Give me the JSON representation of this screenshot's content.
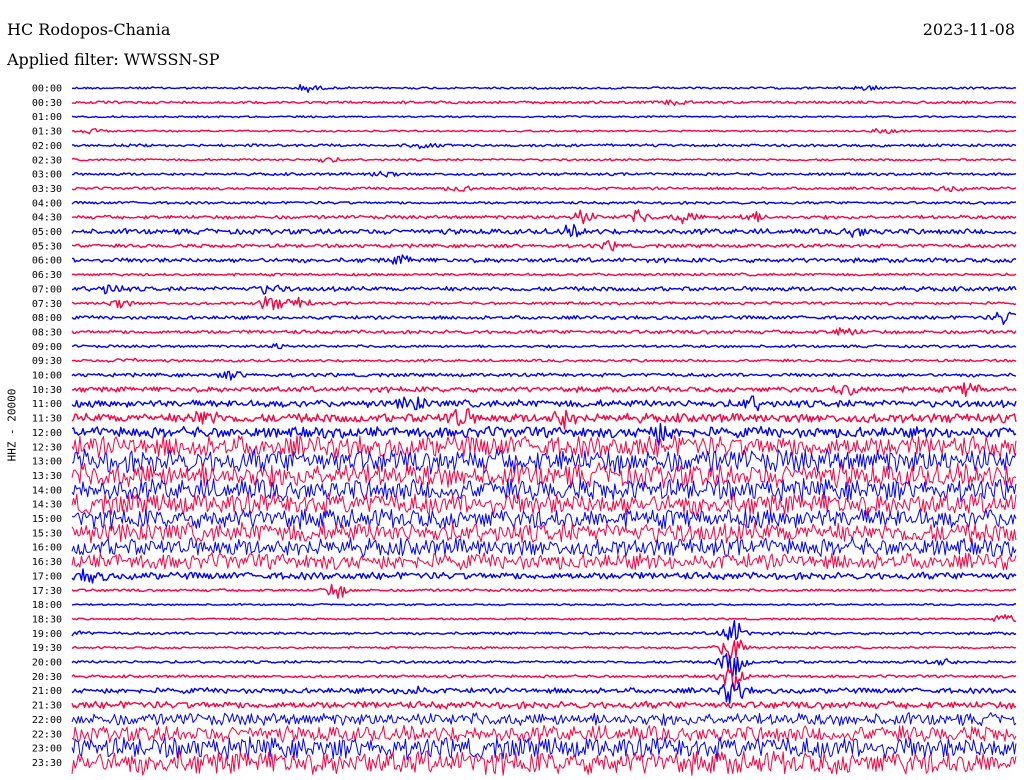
{
  "header": {
    "station": "HC Rodopos-Chania",
    "date": "2023-11-08",
    "filter": "Applied filter: WWSSN-SP"
  },
  "chart_data": {
    "type": "line",
    "ylabel": "HHZ - 20000",
    "colors": {
      "even": "#0000ff",
      "odd": "#ff0040"
    },
    "rows": [
      {
        "label": "00:00",
        "amp": 1.2,
        "events": [
          {
            "pos": 0.25,
            "amp": 4
          },
          {
            "pos": 0.84,
            "amp": 3
          }
        ]
      },
      {
        "label": "00:30",
        "amp": 1.5,
        "events": [
          {
            "pos": 0.64,
            "amp": 3
          }
        ]
      },
      {
        "label": "01:00",
        "amp": 1.0,
        "events": []
      },
      {
        "label": "01:30",
        "amp": 1.0,
        "events": [
          {
            "pos": 0.02,
            "amp": 3
          },
          {
            "pos": 0.86,
            "amp": 3
          }
        ]
      },
      {
        "label": "02:00",
        "amp": 1.5,
        "events": [
          {
            "pos": 0.37,
            "amp": 3
          }
        ]
      },
      {
        "label": "02:30",
        "amp": 1.2,
        "events": [
          {
            "pos": 0.27,
            "amp": 3
          }
        ]
      },
      {
        "label": "03:00",
        "amp": 1.5,
        "events": [
          {
            "pos": 0.33,
            "amp": 4
          }
        ]
      },
      {
        "label": "03:30",
        "amp": 1.5,
        "events": [
          {
            "pos": 0.41,
            "amp": 3
          },
          {
            "pos": 0.93,
            "amp": 3
          }
        ]
      },
      {
        "label": "04:00",
        "amp": 1.5,
        "events": []
      },
      {
        "label": "04:30",
        "amp": 2.0,
        "events": [
          {
            "pos": 0.54,
            "amp": 7
          },
          {
            "pos": 0.6,
            "amp": 6
          },
          {
            "pos": 0.65,
            "amp": 6
          },
          {
            "pos": 0.72,
            "amp": 5
          }
        ]
      },
      {
        "label": "05:00",
        "amp": 3.0,
        "events": [
          {
            "pos": 0.53,
            "amp": 5
          },
          {
            "pos": 0.83,
            "amp": 5
          }
        ]
      },
      {
        "label": "05:30",
        "amp": 2.0,
        "events": [
          {
            "pos": 0.57,
            "amp": 4
          }
        ]
      },
      {
        "label": "06:00",
        "amp": 2.5,
        "events": [
          {
            "pos": 0.35,
            "amp": 4
          }
        ]
      },
      {
        "label": "06:30",
        "amp": 1.5,
        "events": []
      },
      {
        "label": "07:00",
        "amp": 2.5,
        "events": [
          {
            "pos": 0.04,
            "amp": 5
          },
          {
            "pos": 0.21,
            "amp": 5
          }
        ]
      },
      {
        "label": "07:30",
        "amp": 1.5,
        "events": [
          {
            "pos": 0.05,
            "amp": 5
          },
          {
            "pos": 0.21,
            "amp": 8
          },
          {
            "pos": 0.24,
            "amp": 6
          }
        ]
      },
      {
        "label": "08:00",
        "amp": 2.0,
        "events": [
          {
            "pos": 0.99,
            "amp": 8
          }
        ]
      },
      {
        "label": "08:30",
        "amp": 2.0,
        "events": [
          {
            "pos": 0.82,
            "amp": 5
          }
        ]
      },
      {
        "label": "09:00",
        "amp": 1.5,
        "events": [
          {
            "pos": 0.22,
            "amp": 3
          }
        ]
      },
      {
        "label": "09:30",
        "amp": 1.5,
        "events": [
          {
            "pos": 0.06,
            "amp": 3
          }
        ]
      },
      {
        "label": "10:00",
        "amp": 2.0,
        "events": [
          {
            "pos": 0.17,
            "amp": 4
          }
        ]
      },
      {
        "label": "10:30",
        "amp": 3.0,
        "events": [
          {
            "pos": 0.82,
            "amp": 6
          },
          {
            "pos": 0.95,
            "amp": 7
          }
        ]
      },
      {
        "label": "11:00",
        "amp": 4.0,
        "events": [
          {
            "pos": 0.36,
            "amp": 7
          },
          {
            "pos": 0.72,
            "amp": 6
          }
        ]
      },
      {
        "label": "11:30",
        "amp": 5.0,
        "events": [
          {
            "pos": 0.14,
            "amp": 9
          },
          {
            "pos": 0.41,
            "amp": 10
          },
          {
            "pos": 0.52,
            "amp": 9
          }
        ]
      },
      {
        "label": "12:00",
        "amp": 6.0,
        "events": [
          {
            "pos": 0.62,
            "amp": 10
          }
        ]
      },
      {
        "label": "12:30",
        "amp": 12.0,
        "events": []
      },
      {
        "label": "13:00",
        "amp": 13.0,
        "events": []
      },
      {
        "label": "13:30",
        "amp": 13.0,
        "events": []
      },
      {
        "label": "14:00",
        "amp": 12.0,
        "events": []
      },
      {
        "label": "14:30",
        "amp": 12.0,
        "events": []
      },
      {
        "label": "15:00",
        "amp": 11.0,
        "events": []
      },
      {
        "label": "15:30",
        "amp": 11.0,
        "events": []
      },
      {
        "label": "16:00",
        "amp": 10.0,
        "events": []
      },
      {
        "label": "16:30",
        "amp": 9.0,
        "events": []
      },
      {
        "label": "17:00",
        "amp": 4.0,
        "events": [
          {
            "pos": 0.02,
            "amp": 6
          }
        ]
      },
      {
        "label": "17:30",
        "amp": 1.5,
        "events": [
          {
            "pos": 0.28,
            "amp": 8
          }
        ]
      },
      {
        "label": "18:00",
        "amp": 1.0,
        "events": []
      },
      {
        "label": "18:30",
        "amp": 1.0,
        "events": [
          {
            "pos": 0.99,
            "amp": 5
          }
        ]
      },
      {
        "label": "19:00",
        "amp": 1.5,
        "events": [
          {
            "pos": 0.0,
            "amp": 4
          },
          {
            "pos": 0.7,
            "amp": 15
          }
        ]
      },
      {
        "label": "19:30",
        "amp": 1.2,
        "events": [
          {
            "pos": 0.7,
            "amp": 20
          }
        ]
      },
      {
        "label": "20:00",
        "amp": 1.5,
        "events": [
          {
            "pos": 0.7,
            "amp": 18
          },
          {
            "pos": 0.92,
            "amp": 5
          }
        ]
      },
      {
        "label": "20:30",
        "amp": 1.5,
        "events": [
          {
            "pos": 0.7,
            "amp": 14
          }
        ]
      },
      {
        "label": "21:00",
        "amp": 3.0,
        "events": [
          {
            "pos": 0.7,
            "amp": 12
          },
          {
            "pos": 0.36,
            "amp": 5
          }
        ]
      },
      {
        "label": "21:30",
        "amp": 4.0,
        "events": []
      },
      {
        "label": "22:00",
        "amp": 7.0,
        "events": []
      },
      {
        "label": "22:30",
        "amp": 9.0,
        "events": []
      },
      {
        "label": "23:00",
        "amp": 12.0,
        "events": []
      },
      {
        "label": "23:30",
        "amp": 13.0,
        "events": []
      }
    ]
  }
}
